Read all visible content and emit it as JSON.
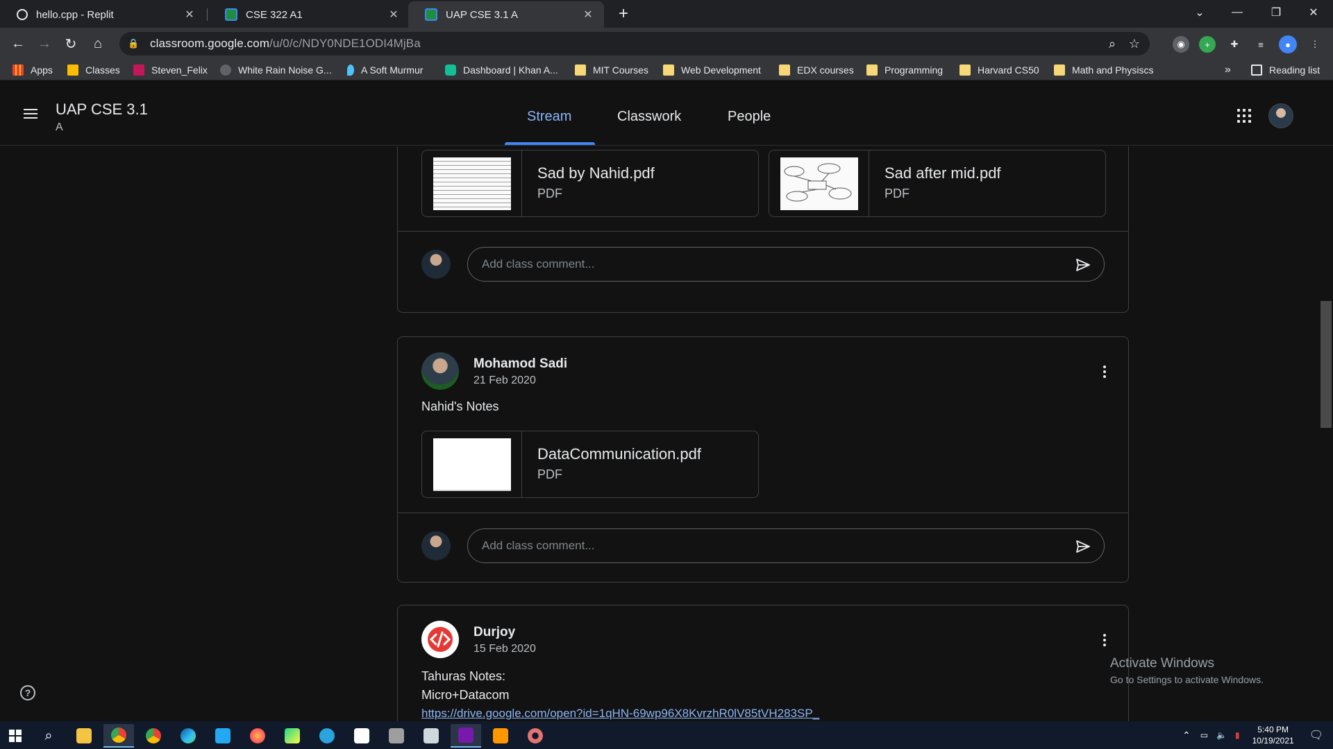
{
  "browser": {
    "tabs": [
      {
        "title": "hello.cpp - Replit",
        "icon": "replit-icon",
        "active": false
      },
      {
        "title": "CSE 322 A1",
        "icon": "classroom-icon",
        "active": false
      },
      {
        "title": "UAP CSE 3.1 A",
        "icon": "classroom-icon",
        "active": true
      }
    ],
    "url_host": "classroom.google.com",
    "url_path": "/u/0/c/NDY0NDE1ODI4MjBa",
    "bookmarks": [
      {
        "label": "Apps",
        "icon": "apps-grid-icon"
      },
      {
        "label": "Classes",
        "icon": "classroom-icon"
      },
      {
        "label": "Steven_Felix",
        "icon": "uva-icon"
      },
      {
        "label": "White Rain Noise G...",
        "icon": "rain-icon"
      },
      {
        "label": "A Soft Murmur",
        "icon": "drop-icon"
      },
      {
        "label": "Dashboard | Khan A...",
        "icon": "khan-icon"
      },
      {
        "label": "MIT Courses",
        "icon": "folder-icon"
      },
      {
        "label": "Web Development",
        "icon": "folder-icon"
      },
      {
        "label": "EDX courses",
        "icon": "folder-icon"
      },
      {
        "label": "Programming",
        "icon": "folder-icon"
      },
      {
        "label": "Harvard CS50",
        "icon": "folder-icon"
      },
      {
        "label": "Math and Physiscs",
        "icon": "folder-icon"
      }
    ],
    "bookmarks_overflow": "»",
    "reading_list": "Reading list"
  },
  "classroom": {
    "title": "UAP CSE 3.1",
    "section": "A",
    "tabs": [
      {
        "label": "Stream",
        "active": true
      },
      {
        "label": "Classwork",
        "active": false
      },
      {
        "label": "People",
        "active": false
      }
    ]
  },
  "stream": {
    "comment_placeholder": "Add class comment...",
    "first_card": {
      "attachments": [
        {
          "name": "Sad by Nahid.pdf",
          "type": "PDF"
        },
        {
          "name": "Sad after mid.pdf",
          "type": "PDF"
        }
      ]
    },
    "posts": [
      {
        "author": "Mohamod Sadi",
        "date": "21 Feb 2020",
        "text": "Nahid's Notes",
        "attachments": [
          {
            "name": "DataCommunication.pdf",
            "type": "PDF"
          }
        ]
      },
      {
        "author": "Durjoy",
        "date": "15 Feb 2020",
        "lines": [
          "Tahuras Notes:",
          "Micro+Datacom"
        ],
        "link": "https://drive.google.com/open?id=1qHN-69wp96X8KvrzhR0lV85tVH283SP_"
      }
    ]
  },
  "watermark": {
    "line1": "Activate Windows",
    "line2": "Go to Settings to activate Windows."
  },
  "taskbar": {
    "time": "5:40 PM",
    "date": "10/19/2021"
  },
  "colors": {
    "accent": "#8ab4f8",
    "tab_underline": "#4285f4",
    "background": "#121212"
  }
}
